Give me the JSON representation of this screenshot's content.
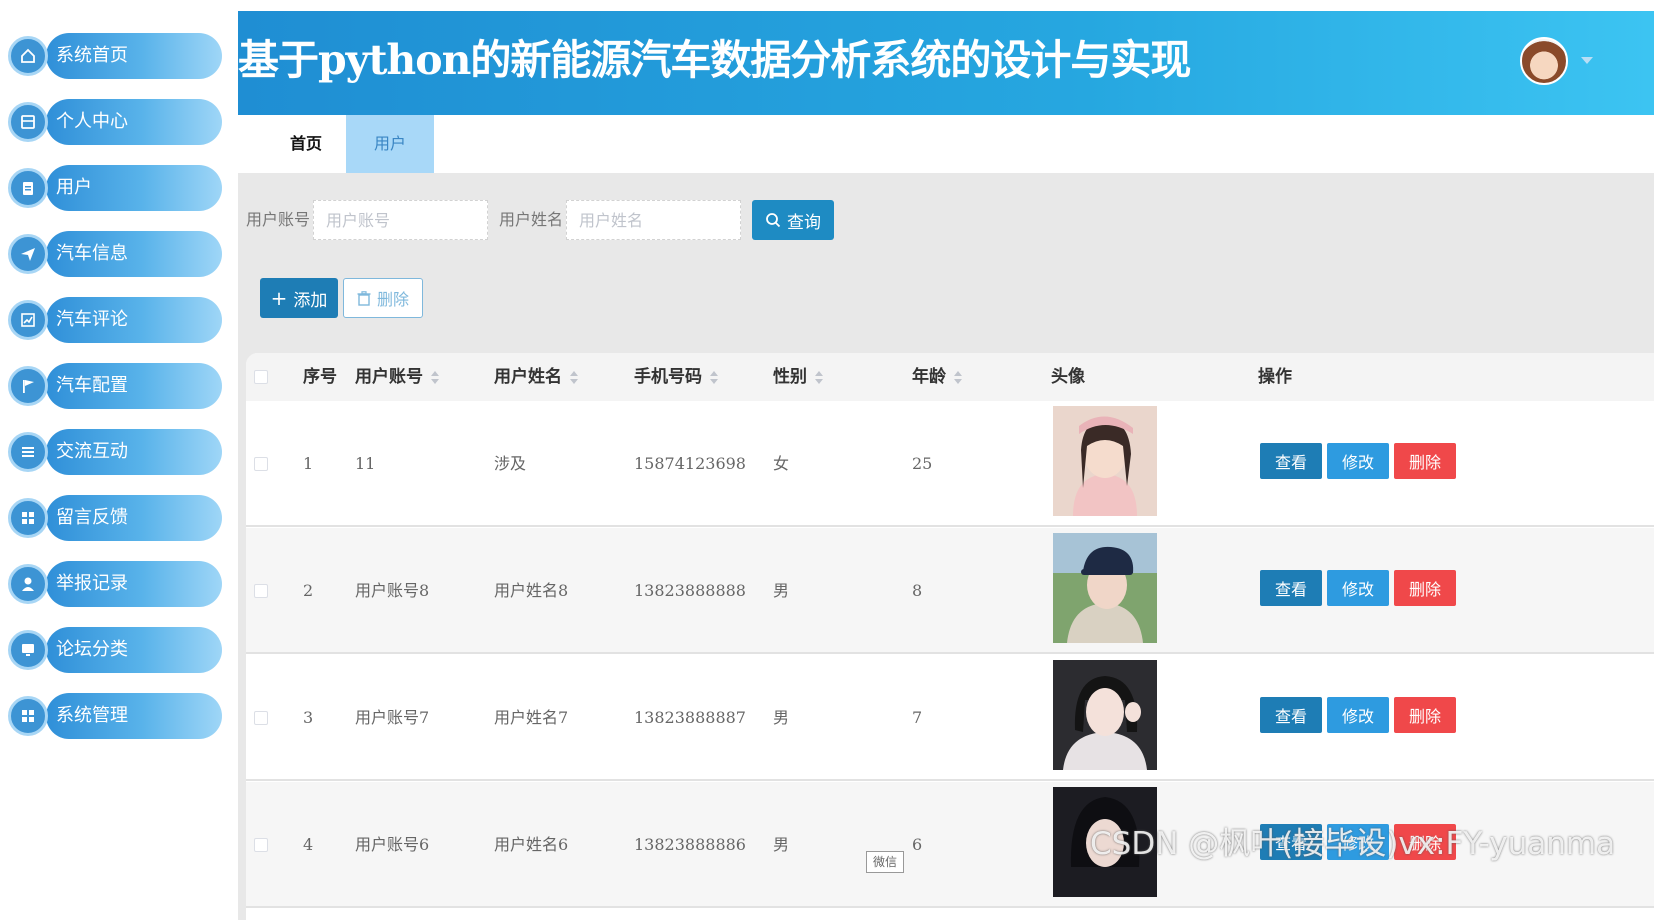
{
  "header": {
    "title": "基于python的新能源汽车数据分析系统的设计与实现"
  },
  "sidebar": {
    "items": [
      {
        "label": "系统首页",
        "icon": "home-icon"
      },
      {
        "label": "个人中心",
        "icon": "profile-card-icon"
      },
      {
        "label": "用户",
        "icon": "clipboard-icon"
      },
      {
        "label": "汽车信息",
        "icon": "paper-plane-icon"
      },
      {
        "label": "汽车评论",
        "icon": "chart-icon"
      },
      {
        "label": "汽车配置",
        "icon": "flag-icon"
      },
      {
        "label": "交流互动",
        "icon": "list-icon"
      },
      {
        "label": "留言反馈",
        "icon": "grid-icon"
      },
      {
        "label": "举报记录",
        "icon": "user-icon"
      },
      {
        "label": "论坛分类",
        "icon": "monitor-icon"
      },
      {
        "label": "系统管理",
        "icon": "grid-icon"
      }
    ]
  },
  "tabs": {
    "home": "首页",
    "user": "用户"
  },
  "search": {
    "account_label": "用户账号",
    "account_placeholder": "用户账号",
    "name_label": "用户姓名",
    "name_placeholder": "用户姓名",
    "query_button": "查询"
  },
  "actions": {
    "add_button": "添加",
    "delete_button": "删除"
  },
  "table": {
    "columns": {
      "index": "序号",
      "account": "用户账号",
      "name": "用户姓名",
      "phone": "手机号码",
      "gender": "性别",
      "age": "年龄",
      "avatar": "头像",
      "operation": "操作"
    },
    "rows": [
      {
        "index": "1",
        "account": "11",
        "name": "涉及",
        "phone": "15874123698",
        "gender": "女",
        "age": "25"
      },
      {
        "index": "2",
        "account": "用户账号8",
        "name": "用户姓名8",
        "phone": "13823888888",
        "gender": "男",
        "age": "8"
      },
      {
        "index": "3",
        "account": "用户账号7",
        "name": "用户姓名7",
        "phone": "13823888887",
        "gender": "男",
        "age": "7"
      },
      {
        "index": "4",
        "account": "用户账号6",
        "name": "用户姓名6",
        "phone": "13823888886",
        "gender": "男",
        "age": "6"
      }
    ],
    "row_buttons": {
      "view": "查看",
      "edit": "修改",
      "delete": "删除"
    }
  },
  "overlay": {
    "wechat_badge": "微信",
    "watermark": "CSDN @枫叶(接毕设)vx:FY-yuanma"
  },
  "colors": {
    "header": "#1f8ed3",
    "primary": "#1e7db5",
    "edit": "#2e9be0",
    "danger": "#f0484a",
    "tab_active": "#a8d8f8"
  }
}
